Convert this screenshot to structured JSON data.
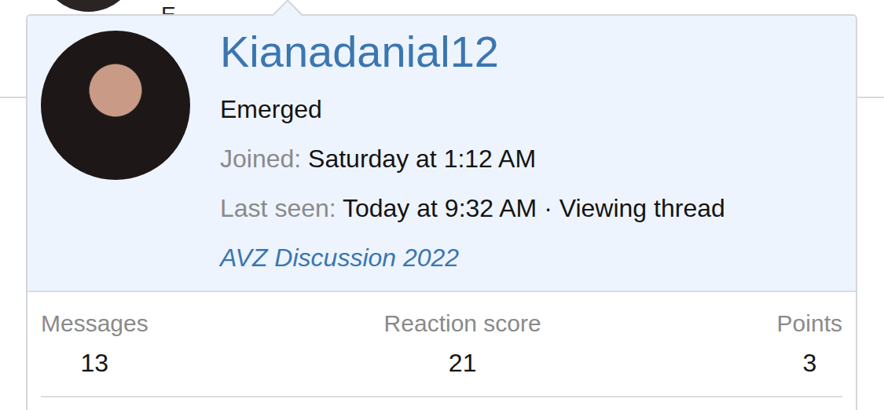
{
  "background": {
    "text": "E"
  },
  "card": {
    "username": "Kianadanial12",
    "title": "Emerged",
    "fields": [
      {
        "label": "Joined:",
        "value": "Saturday at 1:12 AM"
      },
      {
        "label": "Last seen:",
        "value": "Today at 9:32 AM · Viewing thread"
      }
    ],
    "link": "AVZ Discussion 2022",
    "stats": [
      {
        "label": "Messages",
        "value": "13"
      },
      {
        "label": "Reaction score",
        "value": "21"
      },
      {
        "label": "Points",
        "value": "3"
      }
    ]
  }
}
